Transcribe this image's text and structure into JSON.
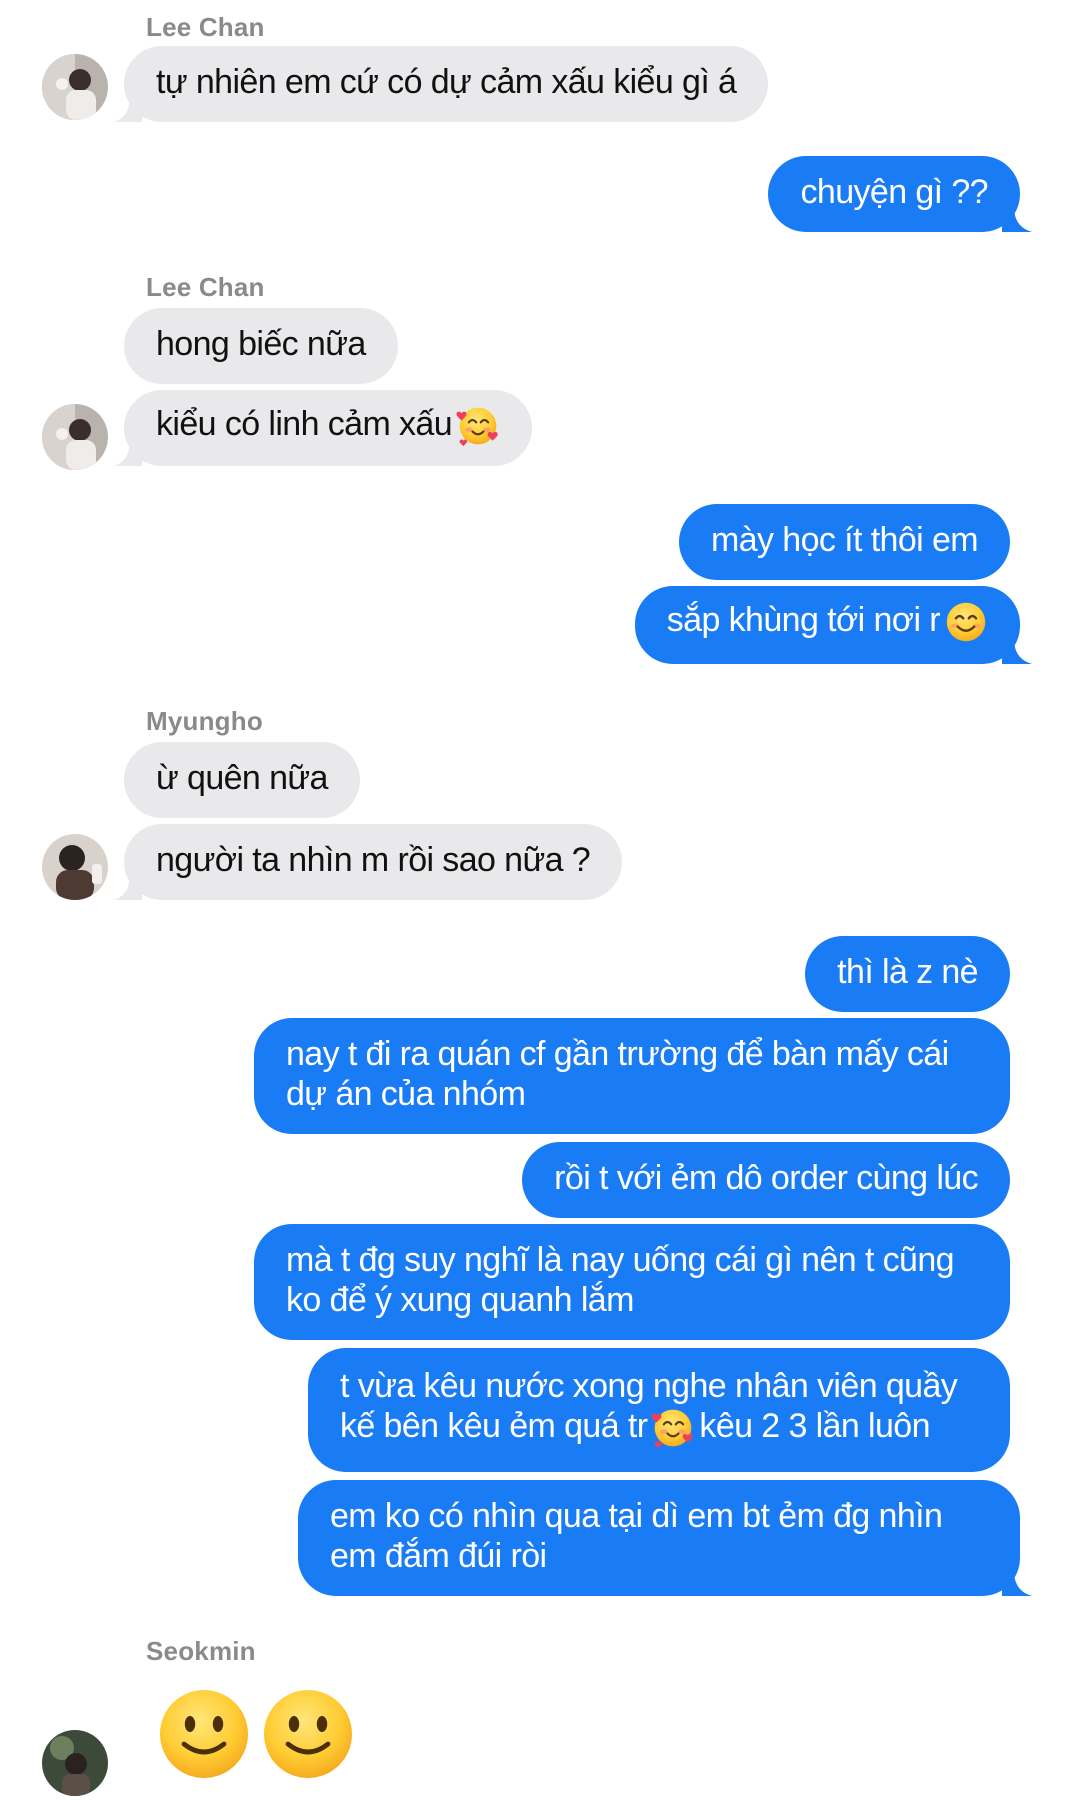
{
  "thread": {
    "g1_sender": "Lee Chan",
    "g1_msg1": "tự nhiên em cứ có dự cảm xấu kiểu gì á",
    "me_msg1": "chuyện gì ??",
    "g2_sender": "Lee Chan",
    "g2_msg1": "hong biếc nữa",
    "g2_msg2": "kiểu có linh cảm xấu",
    "me_msg2": "mày học ít thôi em",
    "me_msg3": "sắp khùng tới nơi r",
    "g3_sender": "Myungho",
    "g3_msg1": "ừ quên nữa",
    "g3_msg2": "người ta nhìn m rồi sao nữa ?",
    "me_msg4": "thì là z nè",
    "me_msg5": "nay t đi ra quán cf gần trường để bàn mấy cái dự án của nhóm",
    "me_msg6": "rồi t với ẻm dô order cùng lúc",
    "me_msg7": "mà t đg suy nghĩ là nay uống cái gì nên t cũng ko để ý xung quanh lắm",
    "me_msg8a": "t vừa kêu nước xong nghe nhân viên quầy kế bên kêu ẻm quá tr",
    "me_msg8b": "kêu 2 3 lần luôn",
    "me_msg9": "em ko có nhìn qua tại dì em bt ẻm đg nhìn em đắm đúi ròi",
    "g4_sender": "Seokmin"
  },
  "colors": {
    "incoming_bubble": "#e9e9eb",
    "outgoing_bubble": "#1a7cf5",
    "sender_name": "#8a8a8e"
  },
  "icons": {
    "hearts_face": "smiling-face-with-hearts-emoji",
    "smiling_face": "smiling-face-with-smiling-eyes-emoji",
    "slight_smile": "slightly-smiling-face-emoji"
  }
}
